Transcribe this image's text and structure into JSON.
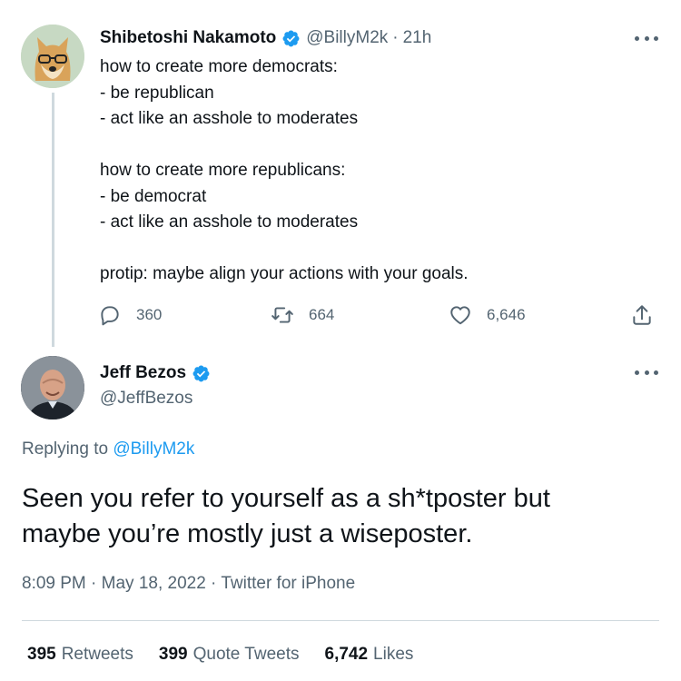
{
  "parent_tweet": {
    "display_name": "Shibetoshi Nakamoto",
    "handle": "@BillyM2k",
    "separator": "·",
    "time": "21h",
    "lines": [
      "how to create more democrats:",
      "- be republican",
      "- act like an asshole to moderates",
      "",
      "how to create more republicans:",
      "- be democrat",
      "- act like an asshole to moderates",
      "",
      "protip: maybe align your actions with your goals."
    ],
    "replies": "360",
    "retweets": "664",
    "likes": "6,646"
  },
  "reply_tweet": {
    "display_name": "Jeff Bezos",
    "handle": "@JeffBezos",
    "replying_to_prefix": "Replying to",
    "replying_to_handle": "@BillyM2k",
    "text_lines": [
      "Seen you refer to yourself as a sh*tposter but",
      "maybe you’re mostly just a wiseposter."
    ],
    "meta": "8:09 PM · May 18, 2022 · Twitter for iPhone",
    "stats": {
      "retweets_count": "395",
      "retweets_label": "Retweets",
      "quotes_count": "399",
      "quotes_label": "Quote Tweets",
      "likes_count": "6,742",
      "likes_label": "Likes"
    }
  },
  "colors": {
    "text": "#0f1419",
    "secondary": "#536471",
    "accent": "#1d9bf0",
    "divider": "#cfd9de"
  },
  "icons": [
    "verified-badge-icon",
    "more-icon",
    "reply-icon",
    "retweet-icon",
    "like-icon",
    "share-icon"
  ]
}
